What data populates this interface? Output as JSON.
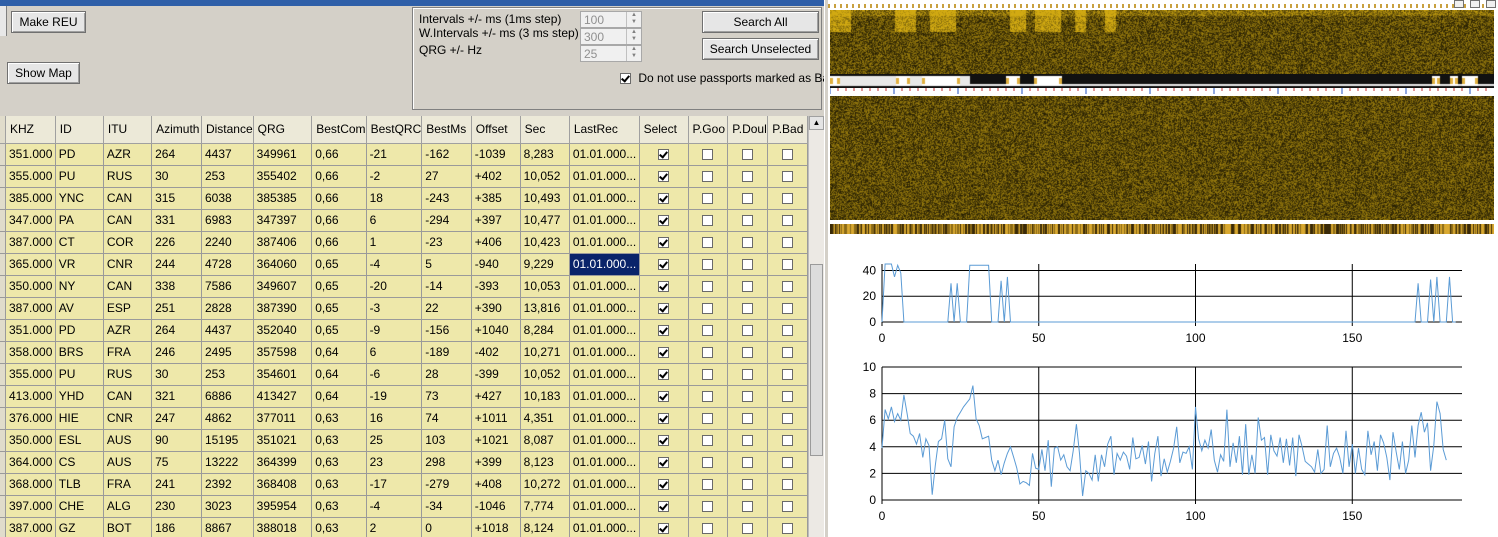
{
  "buttons": {
    "make_reu": "Make REU",
    "show_map": "Show Map",
    "search_all": "Search All",
    "search_unselected": "Search Unselected"
  },
  "settings": {
    "intervals_label": "Intervals +/- ms (1ms step)",
    "intervals_value": "100",
    "w_intervals_label": "W.Intervals +/- ms (3 ms step)",
    "w_intervals_value": "300",
    "qrg_label": "QRG +/- Hz",
    "qrg_value": "25",
    "passports_label": "Do not use passports marked as Bad",
    "passports_checked": true
  },
  "table": {
    "columns": [
      "KHZ",
      "ID",
      "ITU",
      "Azimuth",
      "Distance",
      "QRG",
      "BestCom",
      "BestQRG",
      "BestMs",
      "Offset",
      "Sec",
      "LastRec",
      "Select",
      "P.Good",
      "P.Doubt",
      "P.Bad"
    ],
    "column_display": [
      "KHZ",
      "ID",
      "ITU",
      "Azimuth",
      "Distance",
      "QRG",
      "BestCom",
      "BestQRC",
      "BestMs",
      "Offset",
      "Sec",
      "LastRec",
      "Select",
      "P.Goo",
      "P.Doul",
      "P.Bad"
    ],
    "rows": [
      [
        "351.000",
        "PD",
        "AZR",
        "264",
        "4437",
        "349961",
        "0,66",
        "-21",
        "-162",
        "-1039",
        "8,283",
        "01.01.000...",
        true,
        false,
        false,
        false
      ],
      [
        "355.000",
        "PU",
        "RUS",
        "30",
        "253",
        "355402",
        "0,66",
        "-2",
        "27",
        "+402",
        "10,052",
        "01.01.000...",
        true,
        false,
        false,
        false
      ],
      [
        "385.000",
        "YNC",
        "CAN",
        "315",
        "6038",
        "385385",
        "0,66",
        "18",
        "-243",
        "+385",
        "10,493",
        "01.01.000...",
        true,
        false,
        false,
        false
      ],
      [
        "347.000",
        "PA",
        "CAN",
        "331",
        "6983",
        "347397",
        "0,66",
        "6",
        "-294",
        "+397",
        "10,477",
        "01.01.000...",
        true,
        false,
        false,
        false
      ],
      [
        "387.000",
        "CT",
        "COR",
        "226",
        "2240",
        "387406",
        "0,66",
        "1",
        "-23",
        "+406",
        "10,423",
        "01.01.000...",
        true,
        false,
        false,
        false
      ],
      [
        "365.000",
        "VR",
        "CNR",
        "244",
        "4728",
        "364060",
        "0,65",
        "-4",
        "5",
        "-940",
        "9,229",
        "01.01.000...",
        true,
        false,
        false,
        false
      ],
      [
        "350.000",
        "NY",
        "CAN",
        "338",
        "7586",
        "349607",
        "0,65",
        "-20",
        "-14",
        "-393",
        "10,053",
        "01.01.000...",
        true,
        false,
        false,
        false
      ],
      [
        "387.000",
        "AV",
        "ESP",
        "251",
        "2828",
        "387390",
        "0,65",
        "-3",
        "22",
        "+390",
        "13,816",
        "01.01.000...",
        true,
        false,
        false,
        false
      ],
      [
        "351.000",
        "PD",
        "AZR",
        "264",
        "4437",
        "352040",
        "0,65",
        "-9",
        "-156",
        "+1040",
        "8,284",
        "01.01.000...",
        true,
        false,
        false,
        false
      ],
      [
        "358.000",
        "BRS",
        "FRA",
        "246",
        "2495",
        "357598",
        "0,64",
        "6",
        "-189",
        "-402",
        "10,271",
        "01.01.000...",
        true,
        false,
        false,
        false
      ],
      [
        "355.000",
        "PU",
        "RUS",
        "30",
        "253",
        "354601",
        "0,64",
        "-6",
        "28",
        "-399",
        "10,052",
        "01.01.000...",
        true,
        false,
        false,
        false
      ],
      [
        "413.000",
        "YHD",
        "CAN",
        "321",
        "6886",
        "413427",
        "0,64",
        "-19",
        "73",
        "+427",
        "10,183",
        "01.01.000...",
        true,
        false,
        false,
        false
      ],
      [
        "376.000",
        "HIE",
        "CNR",
        "247",
        "4862",
        "377011",
        "0,63",
        "16",
        "74",
        "+1011",
        "4,351",
        "01.01.000...",
        true,
        false,
        false,
        false
      ],
      [
        "350.000",
        "ESL",
        "AUS",
        "90",
        "15195",
        "351021",
        "0,63",
        "25",
        "103",
        "+1021",
        "8,087",
        "01.01.000...",
        true,
        false,
        false,
        false
      ],
      [
        "364.000",
        "CS",
        "AUS",
        "75",
        "13222",
        "364399",
        "0,63",
        "23",
        "298",
        "+399",
        "8,123",
        "01.01.000...",
        true,
        false,
        false,
        false
      ],
      [
        "368.000",
        "TLB",
        "FRA",
        "241",
        "2392",
        "368408",
        "0,63",
        "-17",
        "-279",
        "+408",
        "10,272",
        "01.01.000...",
        true,
        false,
        false,
        false
      ],
      [
        "397.000",
        "CHE",
        "ALG",
        "230",
        "3023",
        "395954",
        "0,63",
        "-4",
        "-34",
        "-1046",
        "7,774",
        "01.01.000...",
        true,
        false,
        false,
        false
      ],
      [
        "387.000",
        "GZ",
        "BOT",
        "186",
        "8867",
        "388018",
        "0,63",
        "2",
        "0",
        "+1018",
        "8,124",
        "01.01.000...",
        true,
        false,
        false,
        false
      ]
    ],
    "selected_cell": {
      "row": 5,
      "col": "LastRec"
    }
  },
  "chart_data": [
    {
      "type": "line",
      "ylim": [
        0,
        45
      ],
      "yticks": [
        0,
        20,
        40
      ],
      "xlim": [
        0,
        185
      ],
      "xticks": [
        0,
        50,
        100,
        150
      ],
      "grid": true,
      "color": "#5b9bd5",
      "series": [
        {
          "values": [
            0,
            45,
            45,
            45,
            35,
            44,
            38,
            0,
            0,
            0,
            0,
            0,
            0,
            0,
            0,
            0,
            0,
            0,
            0,
            0,
            0,
            0,
            30,
            0,
            30,
            0,
            0,
            0,
            44,
            44,
            44,
            44,
            44,
            44,
            44,
            0,
            0,
            0,
            32,
            0,
            35,
            0,
            0,
            0,
            0,
            0,
            0,
            0,
            0,
            0,
            0,
            0,
            0,
            0,
            0,
            0,
            0,
            0,
            0,
            0,
            0,
            0,
            0,
            0,
            0,
            0,
            0,
            0,
            0,
            0,
            0,
            0,
            0,
            0,
            0,
            0,
            0,
            0,
            0,
            0,
            0,
            0,
            0,
            0,
            0,
            0,
            0,
            0,
            0,
            0,
            0,
            0,
            0,
            0,
            0,
            0,
            0,
            0,
            0,
            0,
            0,
            0,
            0,
            0,
            0,
            0,
            0,
            0,
            0,
            0,
            0,
            0,
            0,
            0,
            0,
            0,
            0,
            0,
            0,
            0,
            0,
            0,
            0,
            0,
            0,
            0,
            0,
            0,
            0,
            0,
            0,
            0,
            0,
            0,
            0,
            0,
            0,
            0,
            0,
            0,
            0,
            0,
            0,
            0,
            0,
            0,
            0,
            0,
            0,
            0,
            0,
            0,
            0,
            0,
            0,
            0,
            0,
            0,
            0,
            0,
            0,
            0,
            0,
            0,
            0,
            0,
            0,
            0,
            0,
            0,
            0,
            30,
            0,
            0,
            0,
            33,
            0,
            35,
            0,
            0,
            0,
            35,
            0,
            0
          ]
        }
      ]
    },
    {
      "type": "line",
      "ylim": [
        0,
        10
      ],
      "yticks": [
        0,
        2,
        4,
        6,
        8,
        10
      ],
      "xlim": [
        0,
        185
      ],
      "xticks": [
        0,
        50,
        100,
        150
      ],
      "grid": true,
      "color": "#5b9bd5",
      "series": [
        {
          "values": [
            3.9,
            6.8,
            6.1,
            7.0,
            5.9,
            6.5,
            6.0,
            7.9,
            6.5,
            5.0,
            4.8,
            4.2,
            5.0,
            3.2,
            4.6,
            4.1,
            0.4,
            2.6,
            4.4,
            4.6,
            6.0,
            3.1,
            2.5,
            5.5,
            6.2,
            6.6,
            7.0,
            7.3,
            7.6,
            8.6,
            6.1,
            5.6,
            4.6,
            4.7,
            4.8,
            3.0,
            2.2,
            3.0,
            1.9,
            2.8,
            3.5,
            4.0,
            3.2,
            2.4,
            1.2,
            1.4,
            1.3,
            1.1,
            3.5,
            2.4,
            2.3,
            3.8,
            2.2,
            4.5,
            1.0,
            3.9,
            4.0,
            3.0,
            3.4,
            2.5,
            2.2,
            3.7,
            5.7,
            3.5,
            0.3,
            2.2,
            2.0,
            1.5,
            3.4,
            1.4,
            3.4,
            2.5,
            4.2,
            4.8,
            1.9,
            3.5,
            3.0,
            3.6,
            3.3,
            2.3,
            4.7,
            3.1,
            3.2,
            4.1,
            2.7,
            4.4,
            1.4,
            3.5,
            4.8,
            1.8,
            3.1,
            2.1,
            2.9,
            3.9,
            5.5,
            2.8,
            3.6,
            3.5,
            4.0,
            2.3,
            7.0,
            4.6,
            3.7,
            4.5,
            3.9,
            5.3,
            3.0,
            2.1,
            3.4,
            2.9,
            6.8,
            2.5,
            4.3,
            2.8,
            4.8,
            1.9,
            5.7,
            1.9,
            3.4,
            2.0,
            6.2,
            4.5,
            4.7,
            1.9,
            4.9,
            3.7,
            3.3,
            4.7,
            2.8,
            4.6,
            2.6,
            4.7,
            1.8,
            4.9,
            4.0,
            2.9,
            2.7,
            2.5,
            2.1,
            3.8,
            2.0,
            2.3,
            5.6,
            2.5,
            3.5,
            3.9,
            3.2,
            2.0,
            5.2,
            2.5,
            4.2,
            2.0,
            3.9,
            2.3,
            1.9,
            5.2,
            3.4,
            4.4,
            2.2,
            4.9,
            4.3,
            3.2,
            1.5,
            5.1,
            3.6,
            2.3,
            4.4,
            2.0,
            3.0,
            5.6,
            3.2,
            5.6,
            6.6,
            5.1,
            5.8,
            2.2,
            4.1,
            7.4,
            6.5,
            3.8,
            3.0
          ]
        }
      ]
    }
  ]
}
